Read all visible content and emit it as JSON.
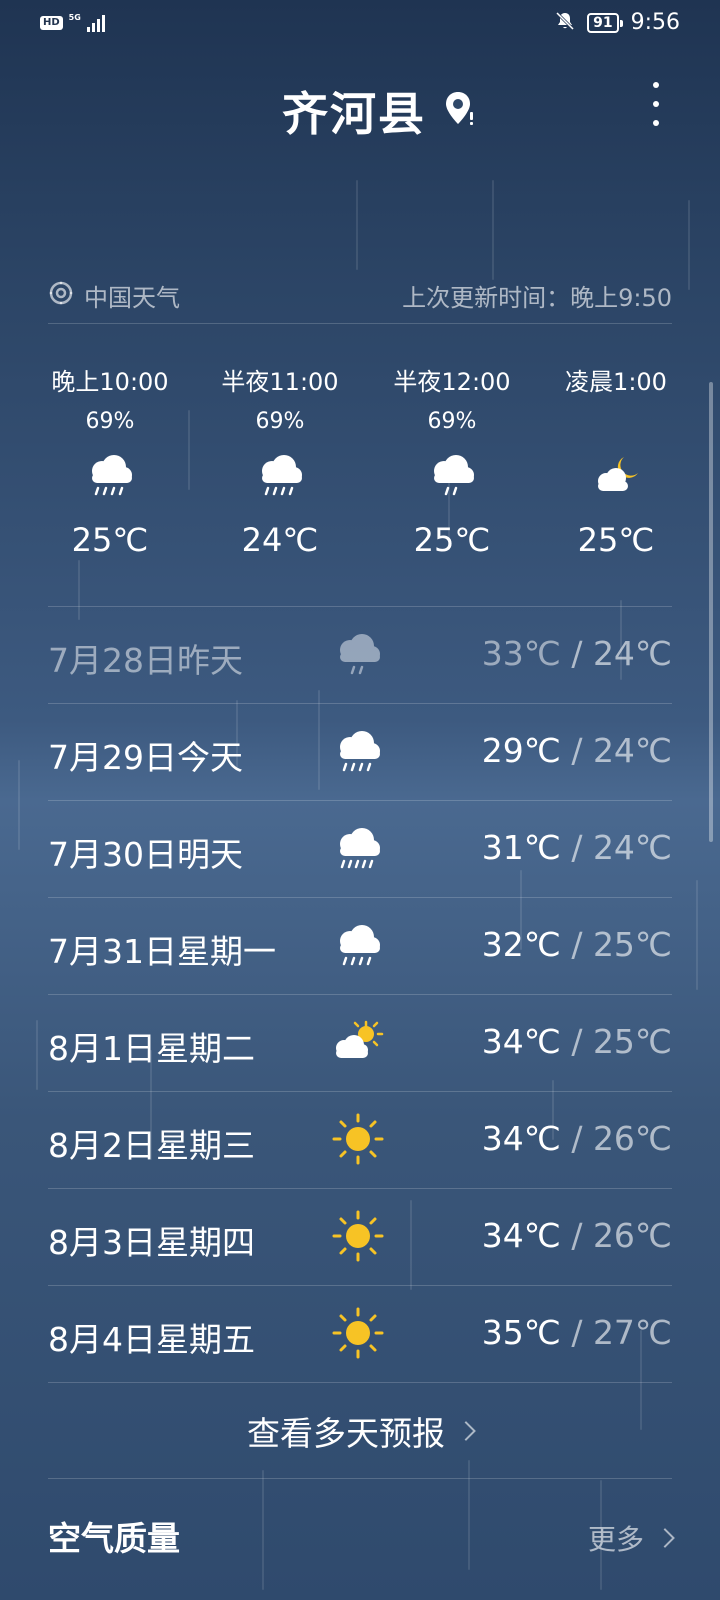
{
  "status_bar": {
    "hd": "HD",
    "network": "5G",
    "battery": "91",
    "time": "9:56",
    "icons": [
      "hd-icon",
      "signal-icon",
      "bell-off-icon",
      "battery-icon"
    ]
  },
  "header": {
    "city": "齐河县",
    "icons": [
      "location-pin-icon",
      "more-vertical-icon"
    ]
  },
  "provider": {
    "name": "中国天气",
    "updated": "上次更新时间：晚上9:50",
    "icon": "provider-logo-icon"
  },
  "hourly": [
    {
      "time": "晚上10:00",
      "precip": "69%",
      "icon": "rain-icon",
      "temp": "25℃"
    },
    {
      "time": "半夜11:00",
      "precip": "69%",
      "icon": "rain-icon",
      "temp": "24℃"
    },
    {
      "time": "半夜12:00",
      "precip": "69%",
      "icon": "light-rain-icon",
      "temp": "25℃"
    },
    {
      "time": "凌晨1:00",
      "precip": "",
      "icon": "cloudy-night-icon",
      "temp": "25℃"
    }
  ],
  "daily": [
    {
      "date": "7月28日昨天",
      "icon": "light-rain-icon",
      "high": "33℃",
      "sep": " / ",
      "low": "24℃",
      "past": true
    },
    {
      "date": "7月29日今天",
      "icon": "rain-icon",
      "high": "29℃",
      "sep": " / ",
      "low": "24℃",
      "past": false
    },
    {
      "date": "7月30日明天",
      "icon": "rain-icon",
      "high": "31℃",
      "sep": " / ",
      "low": "24℃",
      "past": false
    },
    {
      "date": "7月31日星期一",
      "icon": "rain-icon",
      "high": "32℃",
      "sep": " / ",
      "low": "25℃",
      "past": false
    },
    {
      "date": "8月1日星期二",
      "icon": "partly-cloudy-icon",
      "high": "34℃",
      "sep": " / ",
      "low": "25℃",
      "past": false
    },
    {
      "date": "8月2日星期三",
      "icon": "sun-icon",
      "high": "34℃",
      "sep": " / ",
      "low": "26℃",
      "past": false
    },
    {
      "date": "8月3日星期四",
      "icon": "sun-icon",
      "high": "34℃",
      "sep": " / ",
      "low": "26℃",
      "past": false
    },
    {
      "date": "8月4日星期五",
      "icon": "sun-icon",
      "high": "35℃",
      "sep": " / ",
      "low": "27℃",
      "past": false
    }
  ],
  "view_more": "查看多天预报",
  "air_quality": {
    "title": "空气质量",
    "more": "更多"
  },
  "colors": {
    "background_top": "#1f3452",
    "background_mid": "#4a6990",
    "sun": "#f7c325",
    "cloud": "#ffffff"
  }
}
